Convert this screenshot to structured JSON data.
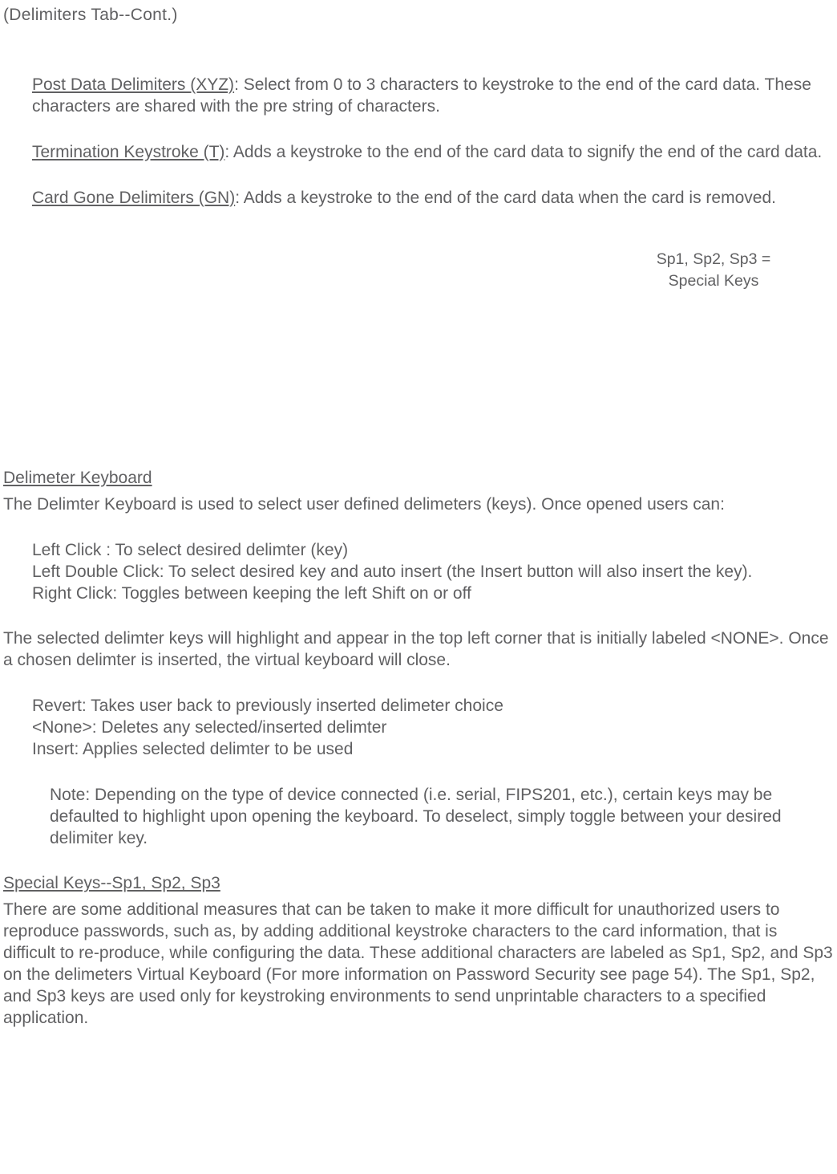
{
  "title": "(Delimiters Tab--Cont.)",
  "post_data": {
    "head": "Post Data Delimiters (XYZ)",
    "body": ": Select from 0 to 3 characters to keystroke to the end of the card data. These characters are shared with the pre string of characters."
  },
  "termination": {
    "head": "Termination Keystroke (T)",
    "body": ": Adds a keystroke to the end of the card data to signify the end of the card data."
  },
  "card_gone": {
    "head": "Card Gone Delimiters (GN)",
    "body": ": Adds a keystroke to the end of the card data when the card is removed."
  },
  "side_note": {
    "line1": "Sp1, Sp2, Sp3 =",
    "line2": "Special Keys"
  },
  "delim_kb": {
    "head": "Delimeter Keyboard",
    "intro": "The Delimter Keyboard is used to select user defined delimeters (keys). Once opened users can:",
    "click1": "Left Click : To select desired delimter (key)",
    "click2": "Left Double Click: To select desired key and auto insert (the Insert button will also insert the key).",
    "click3": "Right Click: Toggles between keeping the left Shift on or off",
    "para2": "The selected delimter keys will highlight and appear in the top left corner that is initially labeled <NONE>. Once a chosen delimter is inserted, the virtual keyboard will close.",
    "revert": "Revert: Takes user back to previously inserted delimeter choice",
    "none": "<None>: Deletes any selected/inserted delimter",
    "insert": "Insert: Applies selected delimter to be used",
    "note": "Note: Depending on the type of device connected (i.e. serial, FIPS201, etc.), certain keys may be defaulted to highlight upon opening the keyboard. To deselect, simply toggle between your desired delimiter key."
  },
  "special": {
    "head": "Special Keys--Sp1, Sp2, Sp3",
    "body": "There are some additional measures that can be taken to make it more difficult for unauthorized users to reproduce passwords, such as, by adding additional keystroke characters to the card information, that is difficult to re-produce, while configuring the data. These additional characters are labeled as Sp1, Sp2, and Sp3 on the delimeters Virtual Keyboard (For more information on Password Security see page 54). The Sp1, Sp2, and Sp3 keys are used only for keystroking environments to send unprintable characters to a specified application."
  }
}
